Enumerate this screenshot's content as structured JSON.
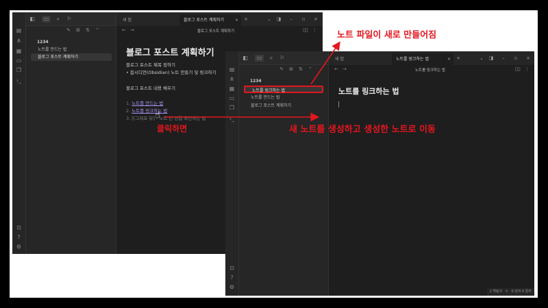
{
  "win1": {
    "vault_name": "1234",
    "files": [
      "노트를 만드는 법",
      "블로그 포스트 계획하기"
    ],
    "tabs": {
      "new_tab": "새 탭",
      "active_tab": "블로그 포스트 계획하기"
    },
    "nav_title": "블로그 포스트 계획하기",
    "doc_title": "블로그 포스트 계획하기",
    "lines": {
      "l1": "블로그 포스트 제목 정하기",
      "l2": "• 옵시디언(Obsidian) 노트 만들기 및 링크하기",
      "l3": "블로그 포스트 내용 채우기",
      "n1": "1.",
      "i1": "노트를 만드는 법",
      "n2": "2.",
      "i2": "노트를 링크하는 법",
      "n3": "3.",
      "i3": "[[그래프 뷰] - 노트 간 연결 확인하는 법"
    }
  },
  "win2": {
    "vault_name": "1234",
    "files": [
      "노트를 링크하는 법",
      "노트를 만드는 법",
      "블로그 포스트 계획하기"
    ],
    "tabs": {
      "new_tab": "새 탭",
      "active_tab": "노트를 링크하는 법"
    },
    "nav_title": "노트를 링크하는 법",
    "doc_title": "노트를 링크하는 법",
    "status": {
      "backlinks": "1 백링크",
      "counts": "0 단어  0 문자"
    }
  },
  "annotations": {
    "file_created": "노트 파일이 새로 만들어짐",
    "on_click": "클릭하면",
    "navigate": "새 노트를 생성하고 생성한 노트로 이동"
  },
  "colors": {
    "annotation_red": "#e4161e",
    "link": "#a991f5",
    "background": "#1e1e1e"
  }
}
